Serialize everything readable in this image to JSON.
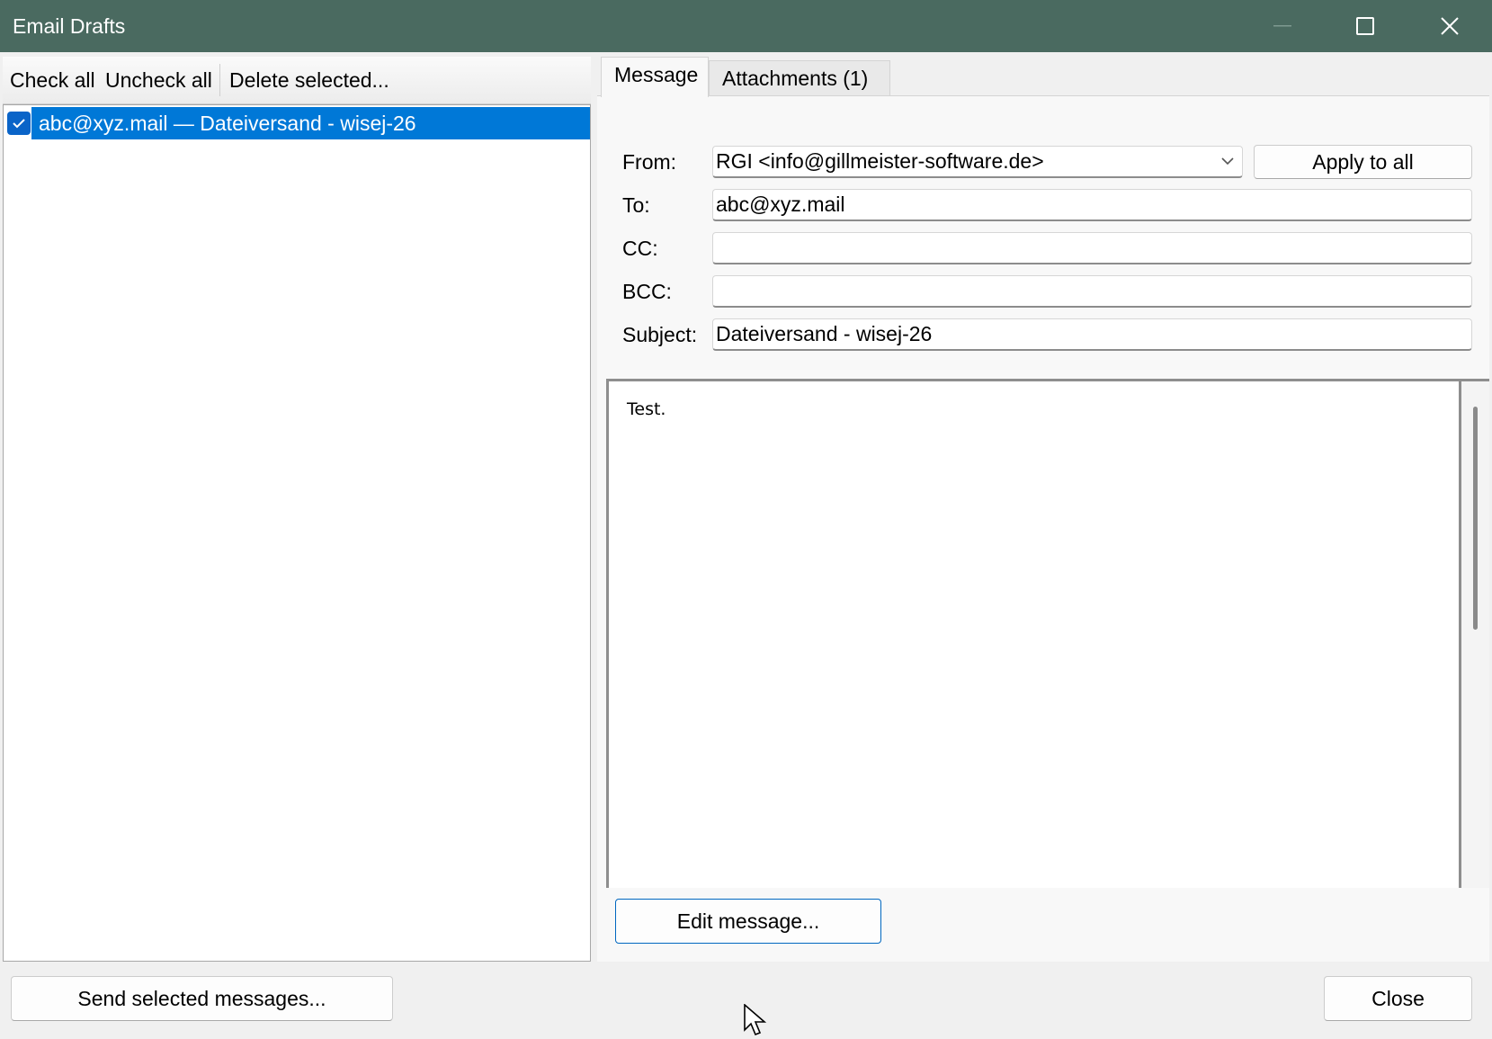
{
  "window": {
    "title": "Email Drafts"
  },
  "toolbar": {
    "check_all": "Check all",
    "uncheck_all": "Uncheck all",
    "delete_selected": "Delete selected..."
  },
  "drafts": [
    {
      "label": "abc@xyz.mail — Dateiversand - wisej-26",
      "checked": true,
      "selected": true
    }
  ],
  "tabs": [
    {
      "label": "Message",
      "active": true
    },
    {
      "label": "Attachments (1)",
      "active": false
    }
  ],
  "form": {
    "from_label": "From:",
    "from_value": "RGI <info@gillmeister-software.de>",
    "apply_to_all": "Apply to all",
    "to_label": "To:",
    "to_value": "abc@xyz.mail",
    "cc_label": "CC:",
    "cc_value": "",
    "bcc_label": "BCC:",
    "bcc_value": "",
    "subject_label": "Subject:",
    "subject_value": "Dateiversand - wisej-26"
  },
  "message": {
    "body": "Test.",
    "edit_button": "Edit message..."
  },
  "footer": {
    "send_button": "Send selected messages...",
    "close_button": "Close"
  },
  "colors": {
    "titlebar": "#4a6a60",
    "selection": "#0078d7",
    "accent": "#0067c0"
  }
}
